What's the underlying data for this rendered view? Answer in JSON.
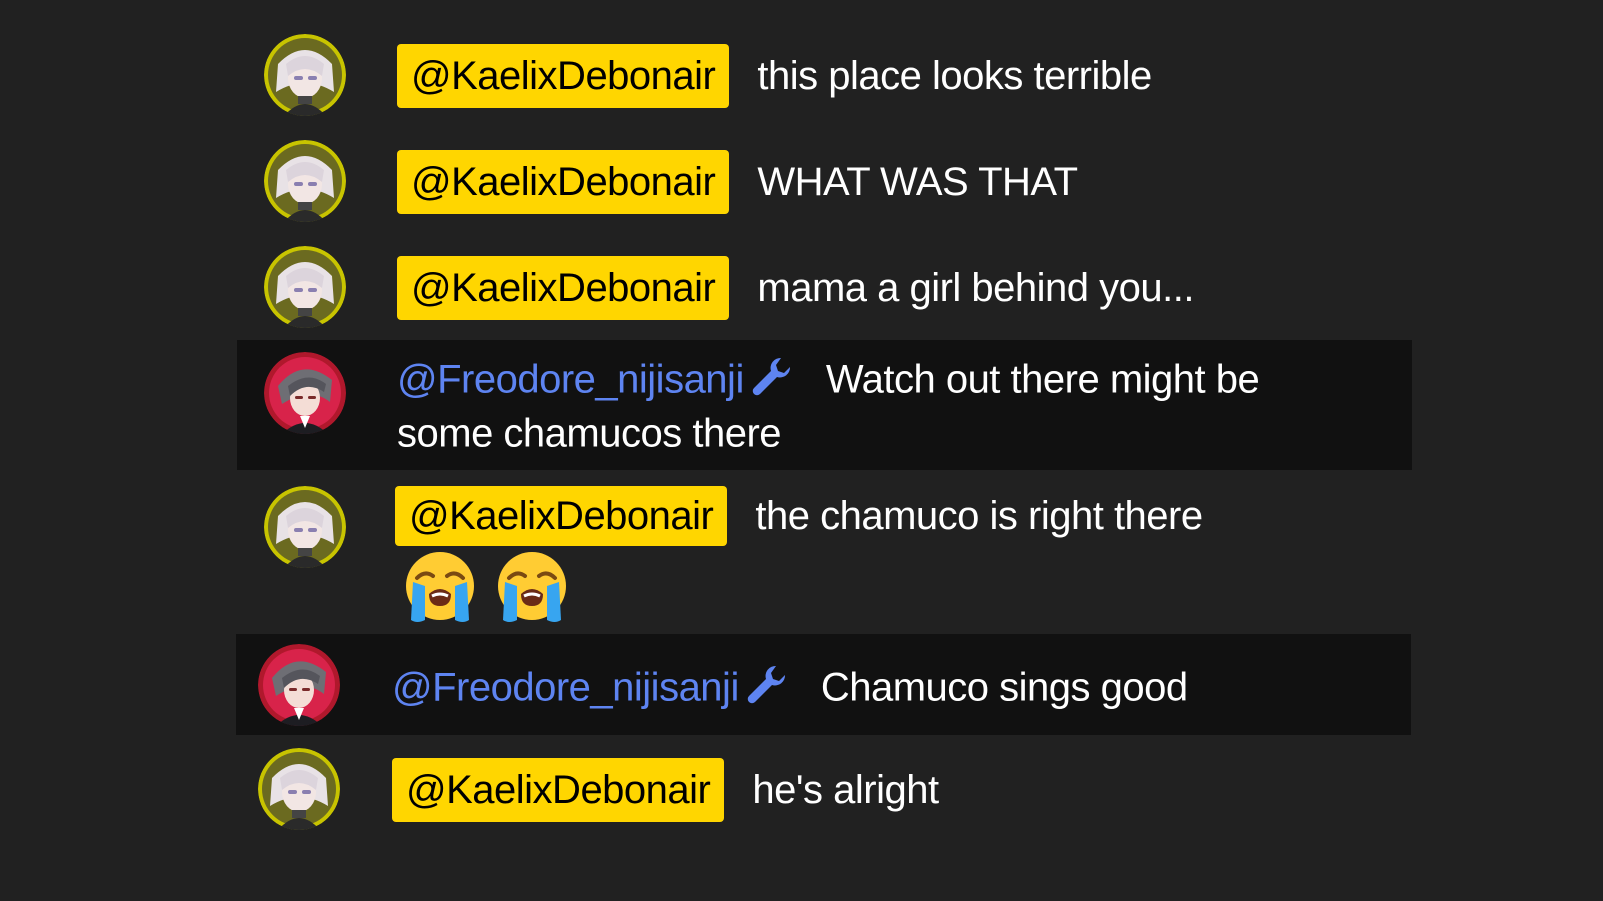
{
  "colors": {
    "background": "#212121",
    "highlight_row": "#111111",
    "owner_chip": "#ffd600",
    "moderator_name": "#5e84f1",
    "message_text": "#ffffff"
  },
  "messages": [
    {
      "author": "@KaelixDebonair",
      "role": "owner",
      "text": "this place looks terrible"
    },
    {
      "author": "@KaelixDebonair",
      "role": "owner",
      "text": "WHAT WAS THAT"
    },
    {
      "author": "@KaelixDebonair",
      "role": "owner",
      "text": "mama a girl behind you..."
    },
    {
      "author": "@Freodore_nijisanji",
      "role": "moderator",
      "badge_icon": "wrench-icon",
      "text": "Watch out there might be",
      "text_line2": "some chamucos there"
    },
    {
      "author": "@KaelixDebonair",
      "role": "owner",
      "text": "the chamuco is right there",
      "emojis": [
        "loudly-crying-face-icon",
        "loudly-crying-face-icon"
      ]
    },
    {
      "author": "@Freodore_nijisanji",
      "role": "moderator",
      "badge_icon": "wrench-icon",
      "text": "Chamuco sings good"
    },
    {
      "author": "@KaelixDebonair",
      "role": "owner",
      "text": "he's alright"
    }
  ]
}
